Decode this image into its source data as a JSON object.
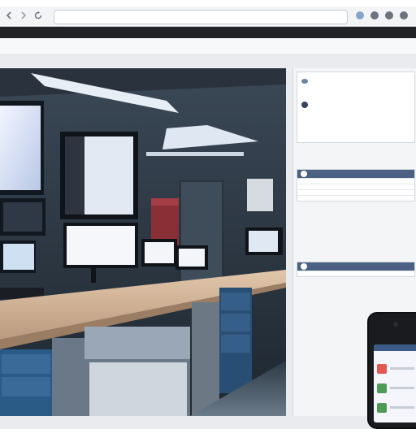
{
  "browser": {
    "address_text": "",
    "tabs": [
      "",
      ""
    ]
  },
  "bookmarks": {
    "title": ""
  },
  "right_pane": {
    "card_1": {
      "title": "",
      "lines": [
        "",
        "",
        "",
        ""
      ]
    },
    "card_2": {
      "title": "",
      "lines": [
        ""
      ]
    }
  },
  "phone": {
    "items": [
      {
        "color": "#e05a4f"
      },
      {
        "color": "#4e9a57"
      },
      {
        "color": "#4e9a57"
      }
    ]
  },
  "colors": {
    "accent": "#4a6183",
    "scene_dark": "#2b3642",
    "desk": "#d7b89c"
  }
}
